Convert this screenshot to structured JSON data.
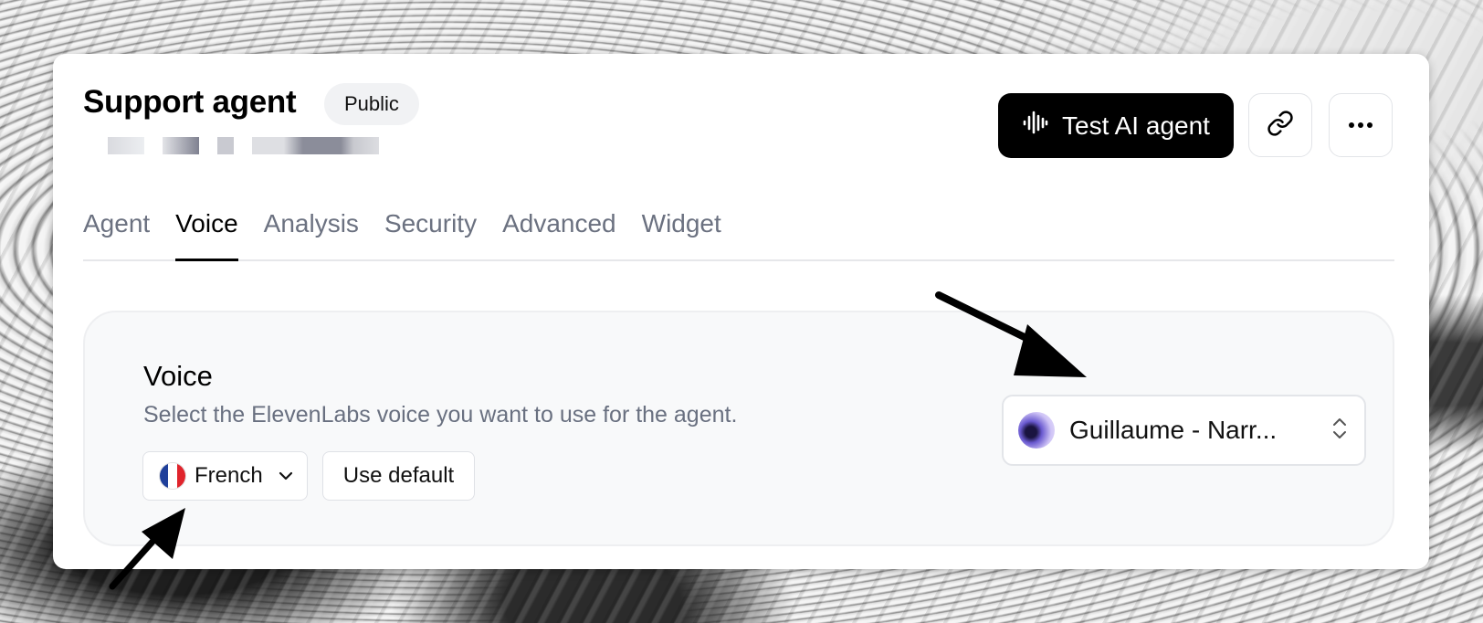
{
  "agent": {
    "title": "Support agent",
    "visibility_badge": "Public"
  },
  "header_actions": {
    "test_label": "Test AI agent",
    "test_icon": "audio-waveform-icon",
    "link_icon": "link-icon",
    "more_icon": "more-horizontal-icon"
  },
  "tabs": [
    {
      "label": "Agent",
      "active": false
    },
    {
      "label": "Voice",
      "active": true
    },
    {
      "label": "Analysis",
      "active": false
    },
    {
      "label": "Security",
      "active": false
    },
    {
      "label": "Advanced",
      "active": false
    },
    {
      "label": "Widget",
      "active": false
    }
  ],
  "voice_section": {
    "title": "Voice",
    "description": "Select the ElevenLabs voice you want to use for the agent.",
    "language": {
      "label": "French",
      "flag_icon": "france-flag-icon",
      "chevron_icon": "chevron-down-icon"
    },
    "use_default_label": "Use default",
    "voice_select": {
      "value": "Guillaume - Narr...",
      "icon": "chevron-up-down-icon"
    }
  },
  "colors": {
    "primary_button": "#000000",
    "tab_inactive": "#6b7180",
    "panel_background": "#f8f9fa"
  }
}
